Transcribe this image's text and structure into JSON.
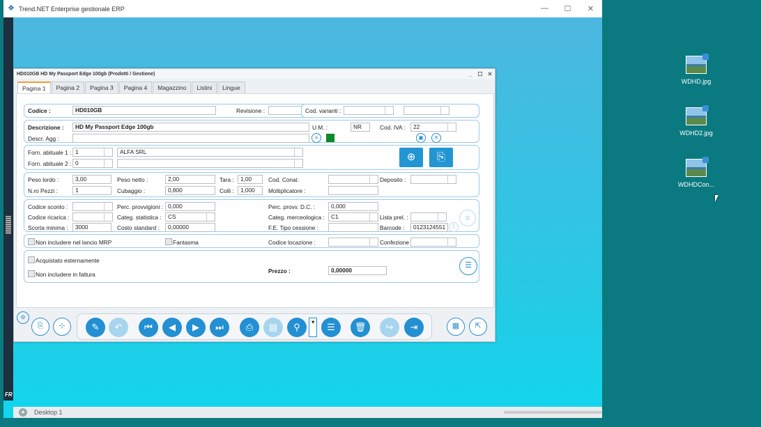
{
  "app": {
    "title": "Trend.NET Enterprise gestionale ERP",
    "controls": {
      "minimize": "—",
      "maximize": "☐",
      "close": "✕"
    },
    "strip_text": "FR"
  },
  "desktop": {
    "icons": [
      {
        "label": "WDHD.jpg"
      },
      {
        "label": "WDHD2.jpg"
      },
      {
        "label": "WDHDCon..."
      }
    ]
  },
  "statusbar": {
    "label": "Desktop 1"
  },
  "dialog": {
    "title": "HD010GB HD My Passport Edge 100gb (Prodotti / Gestione)",
    "tabs": [
      "Pagina 1",
      "Pagina 2",
      "Pagina 3",
      "Pagina 4",
      "Magazzino",
      "Listini",
      "Lingue"
    ],
    "active_tab": "Pagina 1"
  },
  "form": {
    "codice_label": "Codice :",
    "codice": "HD010GB",
    "revisione_label": "Revisione :",
    "revisione": "",
    "cod_varianti_label": "Cod. varianti :",
    "cod_varianti": "",
    "cod_varianti2": "",
    "descrizione_label": "Descrizione :",
    "descrizione": "HD My Passport Edge 100gb",
    "um_label": "U.M. :",
    "um": "NR",
    "cod_iva_label": "Cod. IVA :",
    "cod_iva": "22",
    "descr_agg_label": "Descr. Agg :",
    "descr_agg": "",
    "forn1_label": "Forn. abituale 1 :",
    "forn1": "1",
    "forn1_name": "ALFA SRL",
    "forn2_label": "Forn. abituale 2 :",
    "forn2": "0",
    "forn2_name": "",
    "peso_lordo_label": "Peso lordo :",
    "peso_lordo": "3,00",
    "peso_netto_label": "Peso netto :",
    "peso_netto": "2,00",
    "tara_label": "Tara :",
    "tara": "1,00",
    "cod_conai_label": "Cod. Conai:",
    "cod_conai": "",
    "deposito_label": "Deposito :",
    "deposito": "",
    "nro_pezzi_label": "N.ro Pezzi :",
    "nro_pezzi": "1",
    "cubaggio_label": "Cubaggio :",
    "cubaggio": "0,800",
    "colli_label": "Colli :",
    "colli": "1,000",
    "moltiplicatore_label": "Moltiplicatore :",
    "moltiplicatore": "",
    "codice_sconto_label": "Codice sconto :",
    "codice_sconto": "",
    "perc_provv_label": "Perc. provvigioni :",
    "perc_provv": "0,000",
    "perc_provv_dc_label": "Perc. provv. D.C. :",
    "perc_provv_dc": "0,000",
    "codice_ricarica_label": "Codice ricarica :",
    "codice_ricarica": "",
    "categ_stat_label": "Categ. statistica :",
    "categ_stat": "CS",
    "categ_merc_label": "Categ. merceologica :",
    "categ_merc": "C1",
    "lista_prel_label": "Lista prel. :",
    "lista_prel": "",
    "scorta_min_label": "Scorta minima :",
    "scorta_min": "3000",
    "costo_std_label": "Costo standard :",
    "costo_std": "0,00000",
    "fe_tipo_label": "F.E. Tipo cessione :",
    "fe_tipo": "",
    "barcode_label": "Barcode :",
    "barcode": "0123124551",
    "non_mrp_label": "Non includere nel lancio MRP",
    "fantasma_label": "Fantasma",
    "cod_locazione_label": "Codice locazione :",
    "cod_locazione": "",
    "confezione_label": "Confezione :",
    "confezione": "",
    "acquistato_label": "Acquistato esternamente",
    "non_fattura_label": "Non includere in fattura",
    "prezzo_label": "Prezzo :",
    "prezzo": "0,00000"
  },
  "colors": {
    "accent": "#2290d2",
    "green_swatch": "#0d8a2a",
    "tab_active": "#f0a030"
  }
}
